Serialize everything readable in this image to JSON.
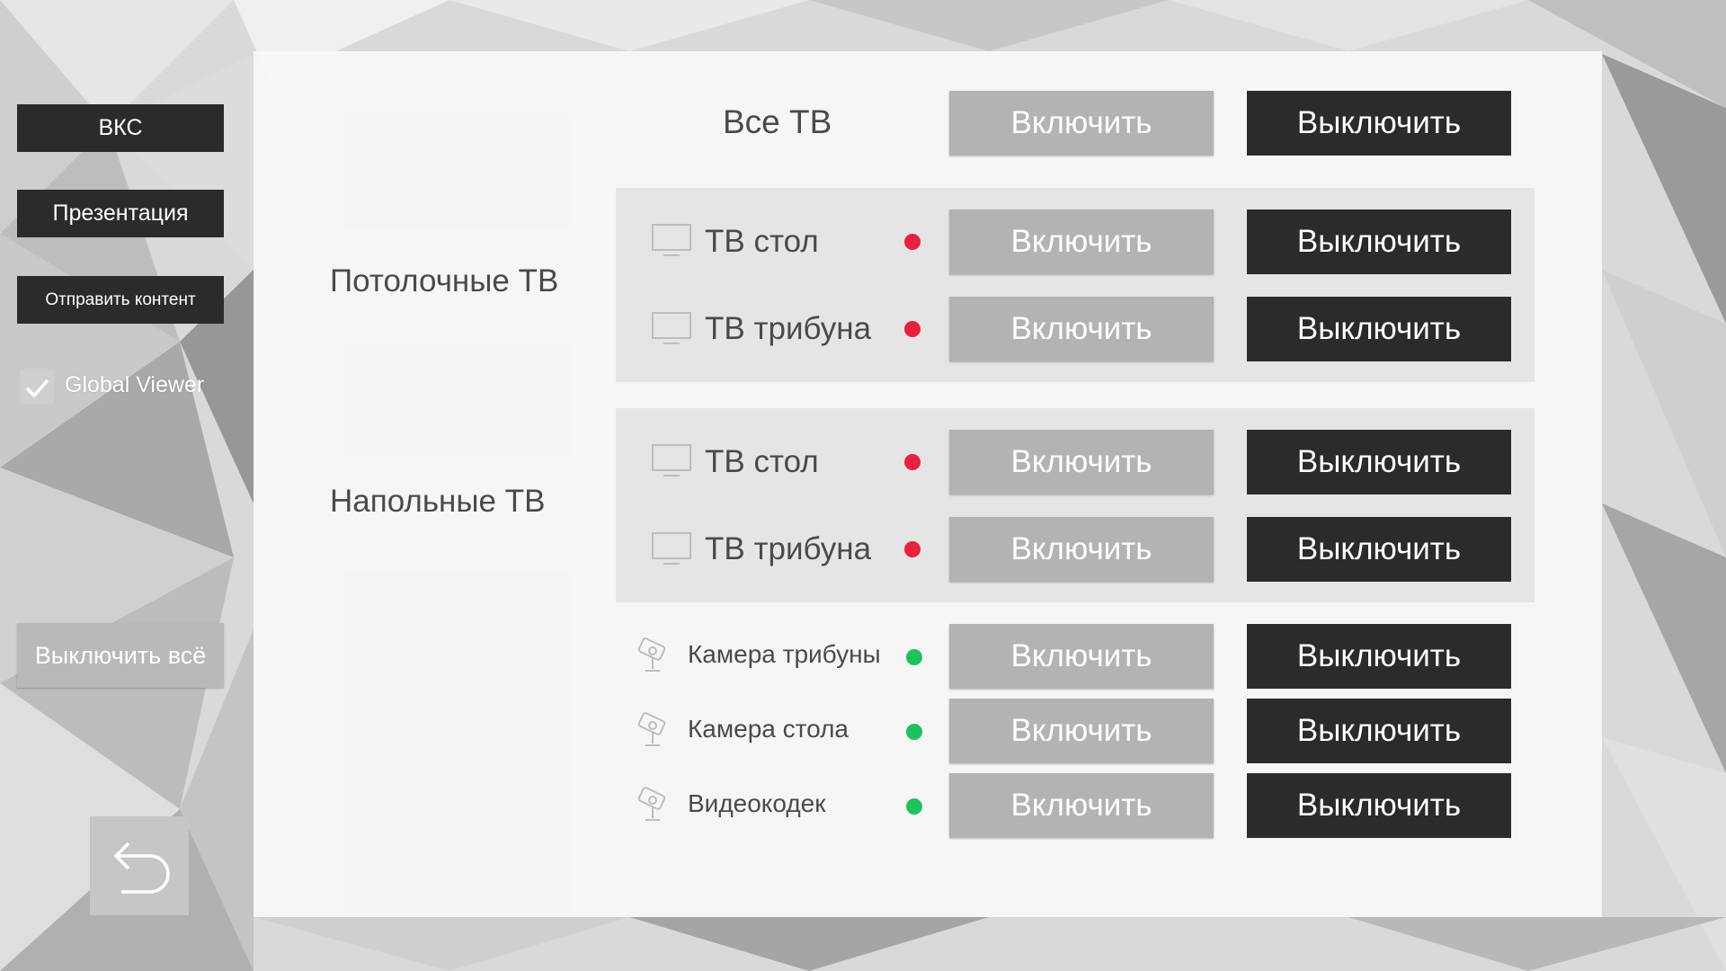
{
  "sidebar": {
    "vks_label": "ВКС",
    "presentation_label": "Презентация",
    "send_content_label": "Отправить контент",
    "global_viewer": {
      "label": "Global Viewer",
      "checked": true
    },
    "turn_off_all_label": "Выключить всё",
    "back_icon": "undo-arrow-icon"
  },
  "all_tv": {
    "title": "Все ТВ",
    "on_label": "Включить",
    "off_label": "Выключить"
  },
  "groups": [
    {
      "title": "Потолочные ТВ",
      "devices": [
        {
          "name": "ТВ стол",
          "status": "off",
          "status_color": "#e8223a",
          "icon": "monitor-icon",
          "on_label": "Включить",
          "off_label": "Выключить"
        },
        {
          "name": "ТВ трибуна",
          "status": "off",
          "status_color": "#e8223a",
          "icon": "monitor-icon",
          "on_label": "Включить",
          "off_label": "Выключить"
        }
      ]
    },
    {
      "title": "Напольные ТВ",
      "devices": [
        {
          "name": "ТВ стол",
          "status": "off",
          "status_color": "#e8223a",
          "icon": "monitor-icon",
          "on_label": "Включить",
          "off_label": "Выключить"
        },
        {
          "name": "ТВ трибуна",
          "status": "off",
          "status_color": "#e8223a",
          "icon": "monitor-icon",
          "on_label": "Включить",
          "off_label": "Выключить"
        }
      ]
    }
  ],
  "cameras": [
    {
      "name": "Камера трибуны",
      "status": "on",
      "status_color": "#1ec25c",
      "icon": "camera-icon",
      "on_label": "Включить",
      "off_label": "Выключить"
    },
    {
      "name": "Камера стола",
      "status": "on",
      "status_color": "#1ec25c",
      "icon": "camera-icon",
      "on_label": "Включить",
      "off_label": "Выключить"
    },
    {
      "name": "Видеокодек",
      "status": "on",
      "status_color": "#1ec25c",
      "icon": "camera-icon",
      "on_label": "Включить",
      "off_label": "Выключить"
    }
  ],
  "colors": {
    "dark_button": "#2b2b2b",
    "light_button": "#b3b3b3",
    "status_off": "#e8223a",
    "status_on": "#1ec25c"
  }
}
